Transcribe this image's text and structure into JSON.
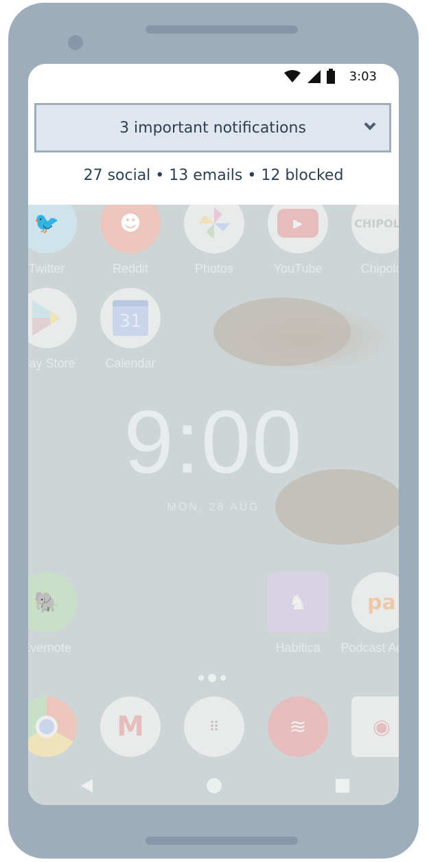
{
  "status_bar": {
    "time": "3:03",
    "icons": [
      "wifi-icon",
      "signal-icon",
      "battery-icon"
    ]
  },
  "notification_bar": {
    "title": "3 important notifications",
    "summary": "27 social • 13 emails • 12 blocked",
    "expand_icon": "chevron-down-icon"
  },
  "home": {
    "row1": [
      {
        "label": "Twitter",
        "color": "#cfe3ec"
      },
      {
        "label": "Reddit",
        "color": "#ecc6bd"
      },
      {
        "label": "Photos",
        "color": "#ebecec"
      },
      {
        "label": "YouTube",
        "color": "#ebecec"
      },
      {
        "label": "Chipolo",
        "color": "#ebecec"
      }
    ],
    "row2": [
      {
        "label": "Play Store",
        "color": "#ebecec"
      },
      {
        "label": "Calendar",
        "color": "#ebecec"
      }
    ],
    "clock": "9:00",
    "date": "MON, 28 AUG",
    "row3": [
      {
        "label": "Evernote",
        "color": "#c8e0c8"
      },
      {
        "label": "Habitica",
        "color": "#d8d2e2"
      },
      {
        "label": "Podcast Addict",
        "color": "#ebecec"
      }
    ],
    "chipolo_logo": "CHIPOLO",
    "calendar_day": "31"
  },
  "dock": [
    "chrome",
    "gmail",
    "app-drawer",
    "todoist",
    "camera"
  ],
  "nav": [
    "back",
    "home",
    "recents"
  ]
}
